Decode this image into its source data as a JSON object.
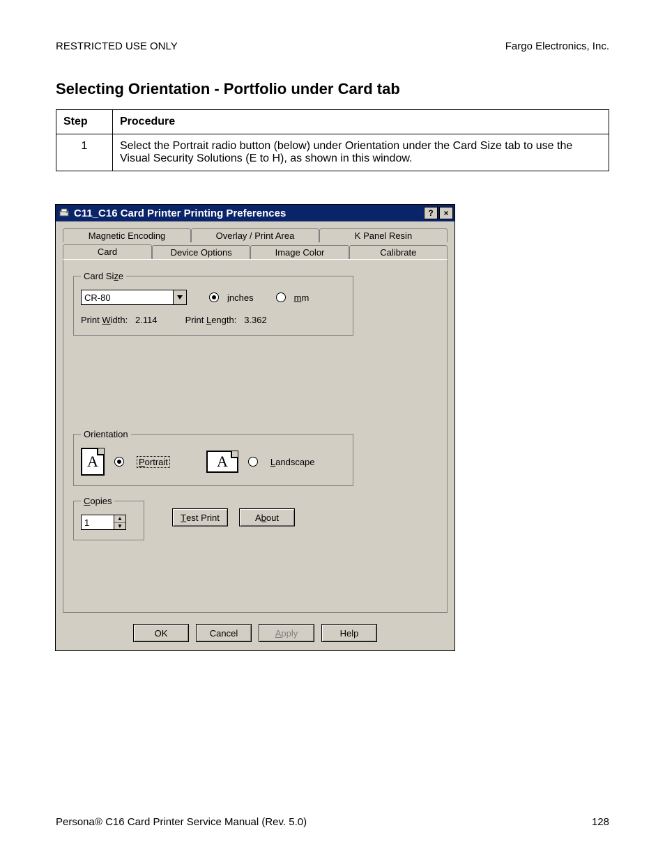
{
  "header": {
    "left": "RESTRICTED USE ONLY",
    "right": "Fargo Electronics, Inc."
  },
  "title": "Selecting Orientation - Portfolio under Card tab",
  "table": {
    "col_step": "Step",
    "col_proc": "Procedure",
    "rows": [
      {
        "step": "1",
        "text": "Select the Portrait radio button (below) under Orientation under the Card Size tab to use the Visual Security Solutions (E to H), as shown in this window."
      }
    ]
  },
  "dialog": {
    "title": "C11_C16 Card Printer Printing Preferences",
    "help_glyph": "?",
    "close_glyph": "×",
    "tabs_back": [
      "Magnetic Encoding",
      "Overlay / Print Area",
      "K Panel Resin"
    ],
    "tabs_front": [
      "Card",
      "Device Options",
      "Image Color",
      "Calibrate"
    ],
    "active_tab": "Card",
    "card_size": {
      "legend_pre": "Card Si",
      "legend_u": "z",
      "legend_post": "e",
      "select_value": "CR-80",
      "units": {
        "inches_u": "i",
        "inches_post": "nches",
        "mm_u": "m",
        "mm_post": "m",
        "selected": "inches"
      },
      "print_width_label_pre": "Print ",
      "print_width_label_u": "W",
      "print_width_label_post": "idth:",
      "print_width_value": "2.114",
      "print_length_label_pre": "Print ",
      "print_length_label_u": "L",
      "print_length_label_post": "ength:",
      "print_length_value": "3.362"
    },
    "orientation": {
      "legend": "Orientation",
      "portrait_u": "P",
      "portrait_post": "ortrait",
      "landscape_u": "L",
      "landscape_post": "andscape",
      "iconA": "A"
    },
    "copies": {
      "legend_u": "C",
      "legend_post": "opies",
      "value": "1"
    },
    "buttons": {
      "test_u": "T",
      "test_post": "est Print",
      "about_pre": "A",
      "about_u": "b",
      "about_post": "out",
      "ok": "OK",
      "cancel": "Cancel",
      "apply_u": "A",
      "apply_post": "pply",
      "help": "Help"
    }
  },
  "footer": {
    "left": "Persona® C16 Card Printer Service Manual (Rev. 5.0)",
    "right": "128"
  }
}
